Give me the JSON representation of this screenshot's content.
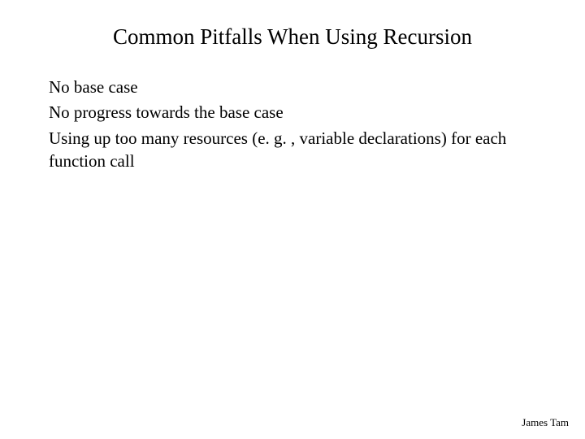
{
  "slide": {
    "title": "Common Pitfalls When Using Recursion",
    "bullets": [
      "No base case",
      "No progress towards the base case",
      "Using up too many resources (e. g. , variable declarations) for each function call"
    ],
    "footer": "James Tam"
  }
}
